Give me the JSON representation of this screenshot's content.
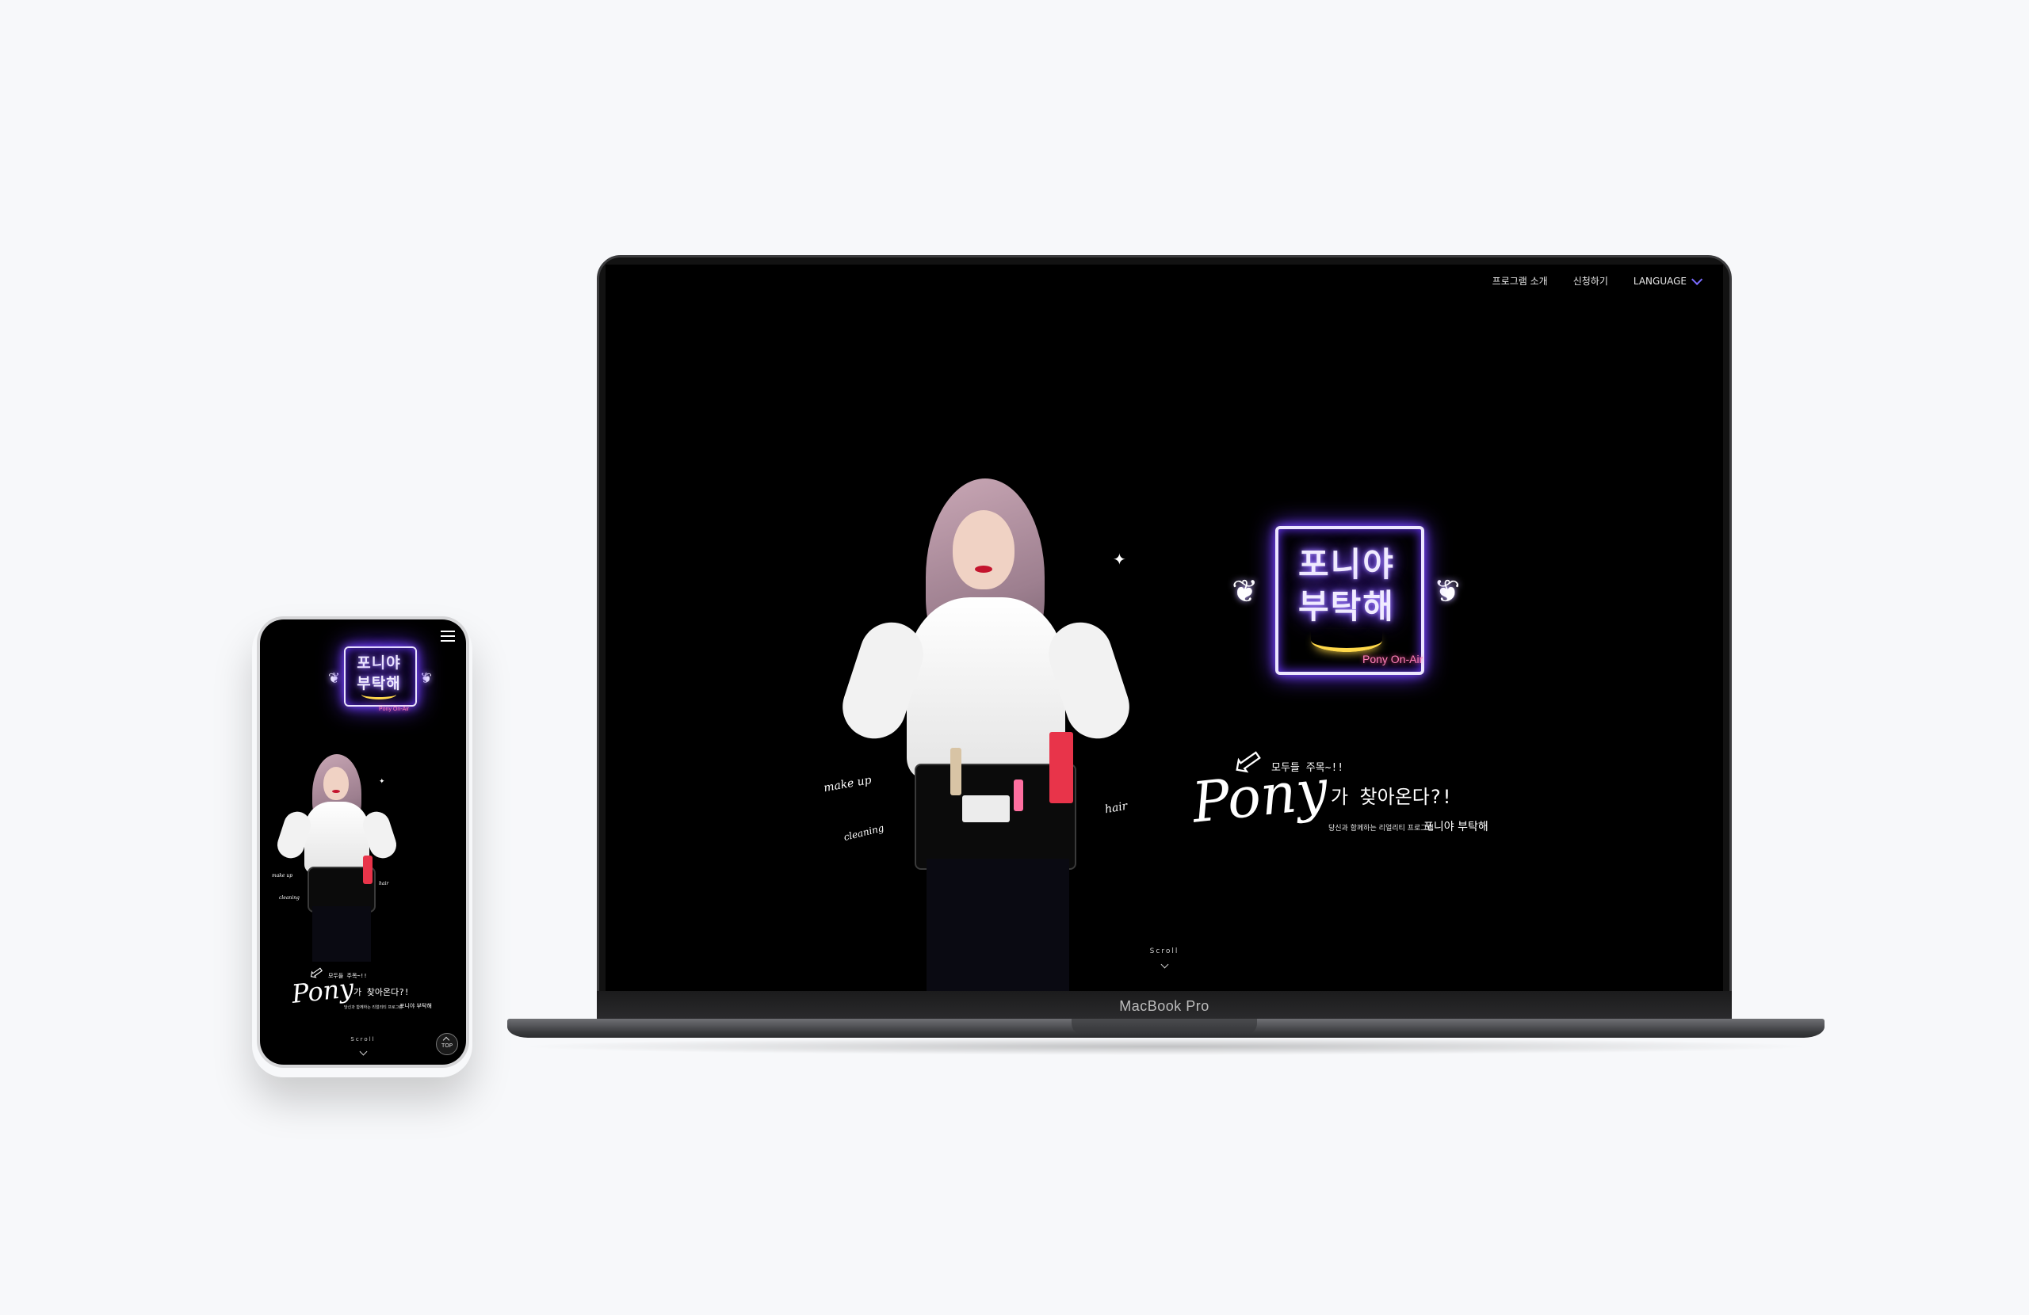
{
  "desktop": {
    "nav": {
      "items": [
        "프로그램 소개",
        "신청하기"
      ],
      "language_label": "LANGUAGE"
    },
    "neon_sign": {
      "line1": "포니야",
      "line2": "부탁해",
      "sub": "Pony On-Air"
    },
    "headline": {
      "top_note": "모두들 주목~!!",
      "script": "Pony",
      "coming": "가 찾아온다?!",
      "desc": "당신과 함께하는 리얼리티 프로그램",
      "desc_bold": "포니야 부탁해"
    },
    "figure_labels": {
      "makeup": "make up",
      "cleaning": "cleaning",
      "hair": "hair"
    },
    "scroll_label": "Scroll"
  },
  "device_label": "MacBook Pro",
  "mobile": {
    "neon_sign": {
      "line1": "포니야",
      "line2": "부탁해",
      "sub": "Pony On-Air"
    },
    "headline": {
      "top_note": "모두들 주목~!!",
      "script": "Pony",
      "coming": "가 찾아온다?!",
      "desc": "당신과 함께하는 리얼리티 프로그램",
      "desc_bold": "포니야 부탁해"
    },
    "figure_labels": {
      "makeup": "make up",
      "cleaning": "cleaning",
      "hair": "hair"
    },
    "scroll_label": "Scroll",
    "top_button": "TOP"
  },
  "colors": {
    "neon_purple": "#7b4dff",
    "neon_yellow": "#ffd84a",
    "neon_pink": "#ff7fb8",
    "accent": "#7b6cff"
  }
}
